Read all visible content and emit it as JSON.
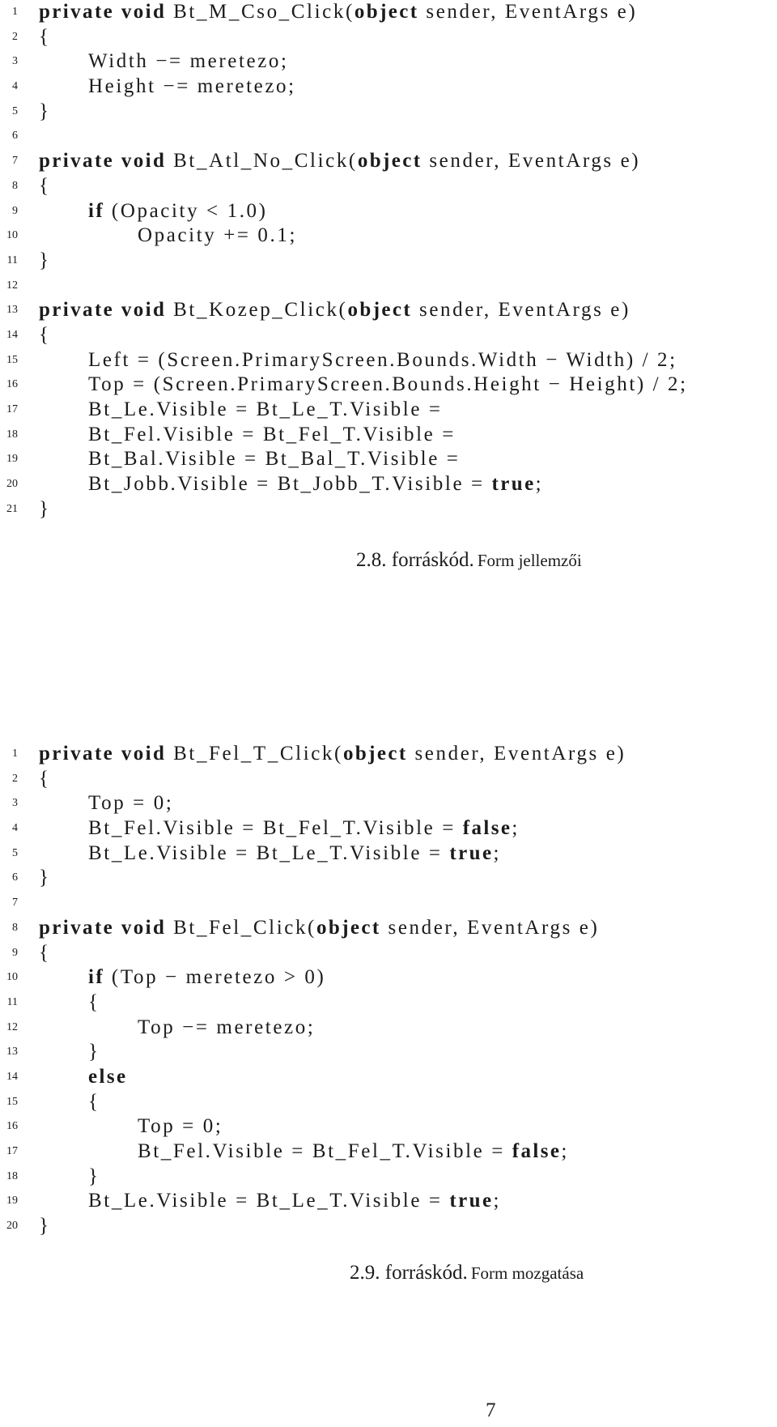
{
  "listings": [
    {
      "caption_label": "2.8. forráskód.",
      "caption_text": "Form jellemzői",
      "lines": [
        {
          "n": "1",
          "indent": 0,
          "tokens": [
            {
              "t": "private void",
              "b": true
            },
            {
              "t": " Bt_M_Cso_Click("
            },
            {
              "t": "object",
              "b": true
            },
            {
              "t": " sender, EventArgs e)"
            }
          ]
        },
        {
          "n": "2",
          "indent": 0,
          "tokens": [
            {
              "t": "{"
            }
          ]
        },
        {
          "n": "3",
          "indent": 1,
          "tokens": [
            {
              "t": "Width −= meretezo;"
            }
          ]
        },
        {
          "n": "4",
          "indent": 1,
          "tokens": [
            {
              "t": "Height −= meretezo;"
            }
          ]
        },
        {
          "n": "5",
          "indent": 0,
          "tokens": [
            {
              "t": "}"
            }
          ]
        },
        {
          "n": "6",
          "indent": 0,
          "tokens": []
        },
        {
          "n": "7",
          "indent": 0,
          "tokens": [
            {
              "t": "private void",
              "b": true
            },
            {
              "t": " Bt_Atl_No_Click("
            },
            {
              "t": "object",
              "b": true
            },
            {
              "t": " sender, EventArgs e)"
            }
          ]
        },
        {
          "n": "8",
          "indent": 0,
          "tokens": [
            {
              "t": "{"
            }
          ]
        },
        {
          "n": "9",
          "indent": 1,
          "tokens": [
            {
              "t": "if",
              "b": true
            },
            {
              "t": " (Opacity < 1.0)"
            }
          ]
        },
        {
          "n": "10",
          "indent": 2,
          "tokens": [
            {
              "t": "Opacity += 0.1;"
            }
          ]
        },
        {
          "n": "11",
          "indent": 0,
          "tokens": [
            {
              "t": "}"
            }
          ]
        },
        {
          "n": "12",
          "indent": 0,
          "tokens": []
        },
        {
          "n": "13",
          "indent": 0,
          "tokens": [
            {
              "t": "private void",
              "b": true
            },
            {
              "t": " Bt_Kozep_Click("
            },
            {
              "t": "object",
              "b": true
            },
            {
              "t": " sender, EventArgs e)"
            }
          ]
        },
        {
          "n": "14",
          "indent": 0,
          "tokens": [
            {
              "t": "{"
            }
          ]
        },
        {
          "n": "15",
          "indent": 1,
          "tokens": [
            {
              "t": "Left = (Screen.PrimaryScreen.Bounds.Width − Width) / 2;"
            }
          ]
        },
        {
          "n": "16",
          "indent": 1,
          "tokens": [
            {
              "t": "Top = (Screen.PrimaryScreen.Bounds.Height − Height) / 2;"
            }
          ]
        },
        {
          "n": "17",
          "indent": 1,
          "tokens": [
            {
              "t": "Bt_Le.Visible = Bt_Le_T.Visible ="
            }
          ]
        },
        {
          "n": "18",
          "indent": 1,
          "tokens": [
            {
              "t": "Bt_Fel.Visible = Bt_Fel_T.Visible ="
            }
          ]
        },
        {
          "n": "19",
          "indent": 1,
          "tokens": [
            {
              "t": "Bt_Bal.Visible = Bt_Bal_T.Visible ="
            }
          ]
        },
        {
          "n": "20",
          "indent": 1,
          "tokens": [
            {
              "t": "Bt_Jobb.Visible = Bt_Jobb_T.Visible = "
            },
            {
              "t": "true",
              "b": true
            },
            {
              "t": ";"
            }
          ]
        },
        {
          "n": "21",
          "indent": 0,
          "tokens": [
            {
              "t": "}"
            }
          ]
        }
      ]
    },
    {
      "caption_label": "2.9. forráskód.",
      "caption_text": "Form mozgatása",
      "lines": [
        {
          "n": "1",
          "indent": 0,
          "tokens": [
            {
              "t": "private void",
              "b": true
            },
            {
              "t": " Bt_Fel_T_Click("
            },
            {
              "t": "object",
              "b": true
            },
            {
              "t": " sender, EventArgs e)"
            }
          ]
        },
        {
          "n": "2",
          "indent": 0,
          "tokens": [
            {
              "t": "{"
            }
          ]
        },
        {
          "n": "3",
          "indent": 1,
          "tokens": [
            {
              "t": "Top = 0;"
            }
          ]
        },
        {
          "n": "4",
          "indent": 1,
          "tokens": [
            {
              "t": "Bt_Fel.Visible = Bt_Fel_T.Visible = "
            },
            {
              "t": "false",
              "b": true
            },
            {
              "t": ";"
            }
          ]
        },
        {
          "n": "5",
          "indent": 1,
          "tokens": [
            {
              "t": "Bt_Le.Visible = Bt_Le_T.Visible = "
            },
            {
              "t": "true",
              "b": true
            },
            {
              "t": ";"
            }
          ]
        },
        {
          "n": "6",
          "indent": 0,
          "tokens": [
            {
              "t": "}"
            }
          ]
        },
        {
          "n": "7",
          "indent": 0,
          "tokens": []
        },
        {
          "n": "8",
          "indent": 0,
          "tokens": [
            {
              "t": "private void",
              "b": true
            },
            {
              "t": " Bt_Fel_Click("
            },
            {
              "t": "object",
              "b": true
            },
            {
              "t": " sender, EventArgs e)"
            }
          ]
        },
        {
          "n": "9",
          "indent": 0,
          "tokens": [
            {
              "t": "{"
            }
          ]
        },
        {
          "n": "10",
          "indent": 1,
          "tokens": [
            {
              "t": "if",
              "b": true
            },
            {
              "t": " (Top − meretezo > 0)"
            }
          ]
        },
        {
          "n": "11",
          "indent": 1,
          "tokens": [
            {
              "t": "{"
            }
          ]
        },
        {
          "n": "12",
          "indent": 2,
          "tokens": [
            {
              "t": "Top −= meretezo;"
            }
          ]
        },
        {
          "n": "13",
          "indent": 1,
          "tokens": [
            {
              "t": "}"
            }
          ]
        },
        {
          "n": "14",
          "indent": 1,
          "tokens": [
            {
              "t": "else",
              "b": true
            }
          ]
        },
        {
          "n": "15",
          "indent": 1,
          "tokens": [
            {
              "t": "{"
            }
          ]
        },
        {
          "n": "16",
          "indent": 2,
          "tokens": [
            {
              "t": "Top = 0;"
            }
          ]
        },
        {
          "n": "17",
          "indent": 2,
          "tokens": [
            {
              "t": "Bt_Fel.Visible = Bt_Fel_T.Visible = "
            },
            {
              "t": "false",
              "b": true
            },
            {
              "t": ";"
            }
          ]
        },
        {
          "n": "18",
          "indent": 1,
          "tokens": [
            {
              "t": "}"
            }
          ]
        },
        {
          "n": "19",
          "indent": 1,
          "tokens": [
            {
              "t": "Bt_Le.Visible = Bt_Le_T.Visible = "
            },
            {
              "t": "true",
              "b": true
            },
            {
              "t": ";"
            }
          ]
        },
        {
          "n": "20",
          "indent": 0,
          "tokens": [
            {
              "t": "}"
            }
          ]
        }
      ]
    }
  ],
  "page_number": "7"
}
